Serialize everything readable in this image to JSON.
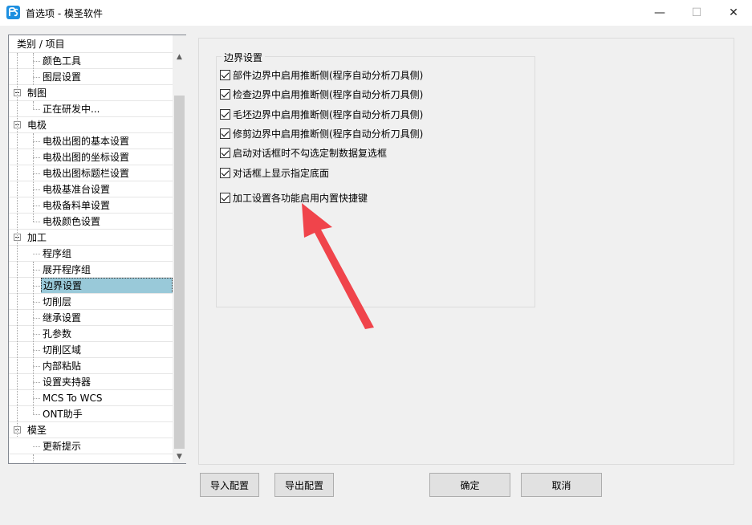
{
  "window": {
    "title": "首选项 - 模圣软件",
    "min_symbol": "—",
    "max_symbol": "☐",
    "close_symbol": "✕"
  },
  "tree": {
    "header": "类别 / 项目",
    "rows": [
      {
        "label": "颜色工具",
        "level": 1
      },
      {
        "label": "图层设置",
        "level": 1
      },
      {
        "label": "制图",
        "level": 0
      },
      {
        "label": "正在研发中...",
        "level": 1
      },
      {
        "label": "电极",
        "level": 0
      },
      {
        "label": "电极出图的基本设置",
        "level": 1
      },
      {
        "label": "电极出图的坐标设置",
        "level": 1
      },
      {
        "label": "电极出图标题栏设置",
        "level": 1
      },
      {
        "label": "电极基准台设置",
        "level": 1
      },
      {
        "label": "电极备料单设置",
        "level": 1
      },
      {
        "label": "电极颜色设置",
        "level": 1
      },
      {
        "label": "加工",
        "level": 0
      },
      {
        "label": "程序组",
        "level": 1
      },
      {
        "label": "展开程序组",
        "level": 1
      },
      {
        "label": "边界设置",
        "level": 1,
        "selected": true
      },
      {
        "label": "切削层",
        "level": 1
      },
      {
        "label": "继承设置",
        "level": 1
      },
      {
        "label": "孔参数",
        "level": 1
      },
      {
        "label": "切削区域",
        "level": 1
      },
      {
        "label": "内部粘贴",
        "level": 1
      },
      {
        "label": "设置夹持器",
        "level": 1
      },
      {
        "label": "MCS To WCS",
        "level": 1
      },
      {
        "label": "ONT助手",
        "level": 1
      },
      {
        "label": "模圣",
        "level": 0
      },
      {
        "label": "更新提示",
        "level": 1
      }
    ],
    "scroll_up": "▲",
    "scroll_down": "▼"
  },
  "boundary": {
    "group_title": "边界设置",
    "options": [
      {
        "label": "部件边界中启用推断侧(程序自动分析刀具侧)",
        "checked": true
      },
      {
        "label": "检查边界中启用推断侧(程序自动分析刀具侧)",
        "checked": true
      },
      {
        "label": "毛坯边界中启用推断侧(程序自动分析刀具侧)",
        "checked": true
      },
      {
        "label": "修剪边界中启用推断侧(程序自动分析刀具侧)",
        "checked": true
      },
      {
        "label": "启动对话框时不勾选定制数据复选框",
        "checked": true
      },
      {
        "label": "对话框上显示指定底面",
        "checked": true
      },
      {
        "label": "加工设置各功能启用内置快捷键",
        "checked": true
      }
    ]
  },
  "buttons": {
    "import": "导入配置",
    "export": "导出配置",
    "ok": "确定",
    "cancel": "取消"
  },
  "colors": {
    "selection": "#99c9d9",
    "annotation_arrow": "#f0444b"
  }
}
